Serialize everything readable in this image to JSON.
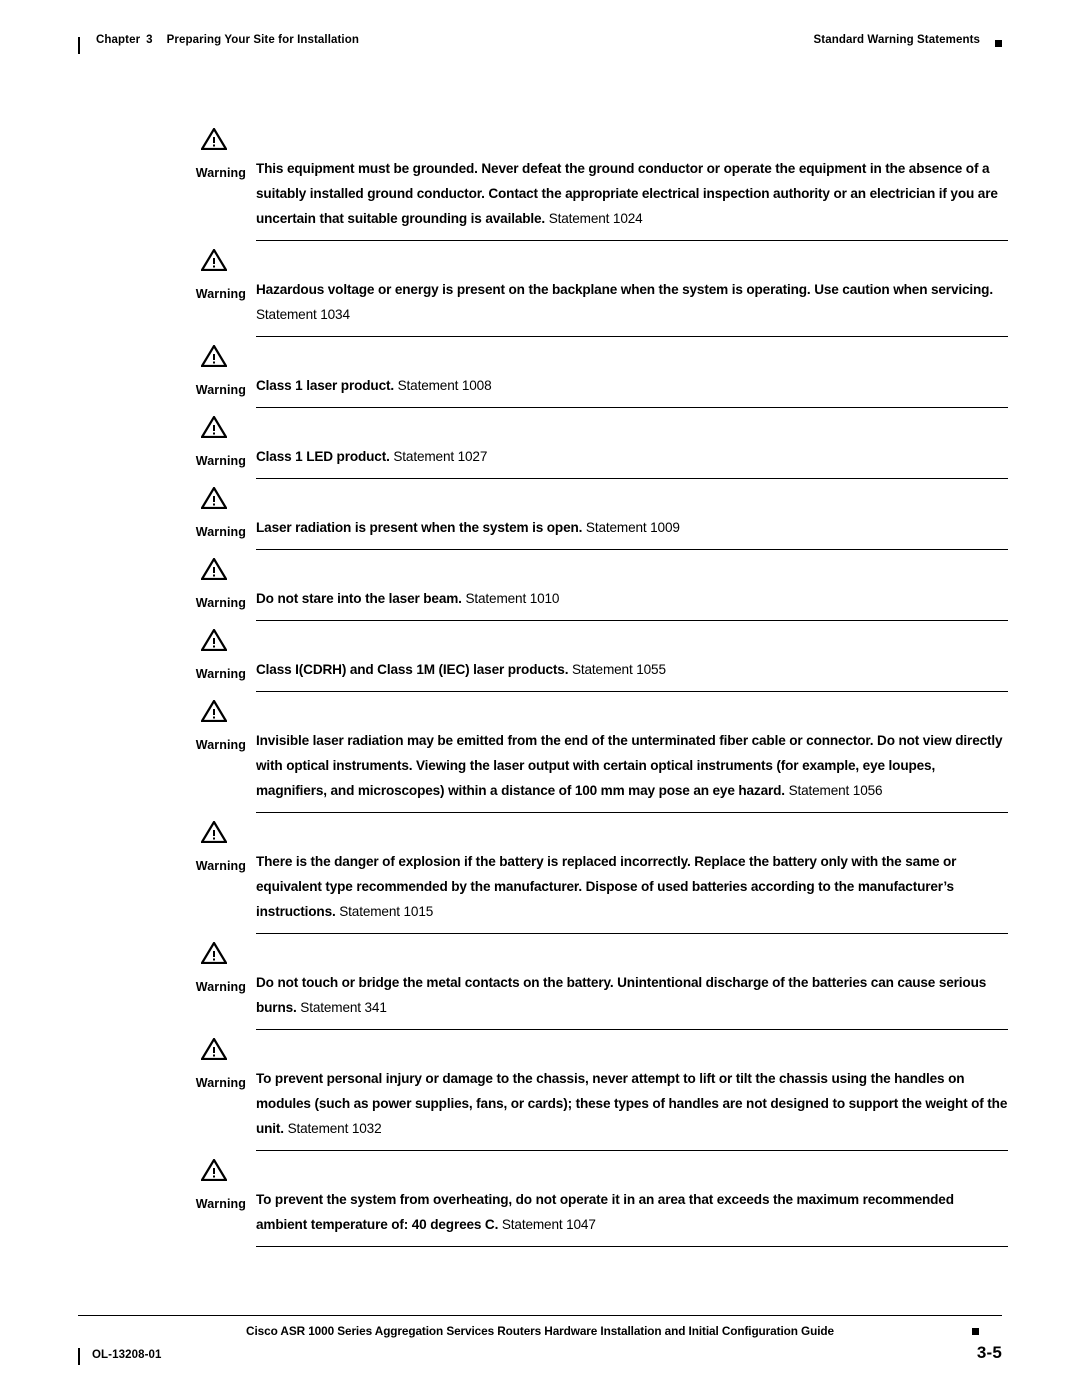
{
  "header": {
    "chapter_label": "Chapter",
    "chapter_number": "3",
    "chapter_title": "Preparing Your Site for Installation",
    "section_title": "Standard Warning Statements"
  },
  "warning_label": "Warning",
  "warnings": [
    {
      "text": "This equipment must be grounded. Never defeat the ground conductor or operate the equipment in the absence of a suitably installed ground conductor. Contact the appropriate electrical inspection authority or an electrician if you are uncertain that suitable grounding is available.",
      "statement": "Statement 1024"
    },
    {
      "text": "Hazardous voltage or energy is present on the backplane when the system is operating. Use caution when servicing.",
      "statement": "Statement 1034"
    },
    {
      "text": "Class 1 laser product.",
      "statement": "Statement 1008"
    },
    {
      "text": "Class 1 LED product.",
      "statement": "Statement 1027"
    },
    {
      "text": "Laser radiation is present when the system is open.",
      "statement": "Statement 1009"
    },
    {
      "text": "Do not stare into the laser beam.",
      "statement": "Statement 1010"
    },
    {
      "text": "Class I(CDRH) and Class 1M (IEC) laser products.",
      "statement": "Statement 1055"
    },
    {
      "text": "Invisible laser radiation may be emitted from the end of the unterminated fiber cable or connector. Do not view directly with optical instruments. Viewing the laser output with certain optical instruments (for example, eye loupes, magnifiers, and microscopes) within a distance of 100 mm may pose an eye hazard.",
      "statement": "Statement 1056"
    },
    {
      "text": "There is the danger of explosion if the battery is replaced incorrectly.  Replace the battery only with the same or equivalent type recommended by the manufacturer. Dispose of used batteries according to the manufacturer’s instructions.",
      "statement": "Statement 1015"
    },
    {
      "text": "Do not touch or bridge the metal contacts on the battery. Unintentional discharge of the batteries can cause serious burns.",
      "statement": "Statement 341"
    },
    {
      "text": "To prevent personal injury or damage to the chassis, never attempt to lift or tilt the chassis using the handles on modules (such as power supplies, fans, or cards); these types of handles are not designed to support the weight of the unit.",
      "statement": "Statement 1032"
    },
    {
      "text": "To prevent the system from overheating, do not operate it in an area that exceeds the maximum recommended ambient temperature of: 40 degrees C.",
      "statement": "Statement 1047"
    }
  ],
  "footer": {
    "title": "Cisco ASR 1000 Series Aggregation Services Routers Hardware Installation and Initial Configuration Guide",
    "doc_id": "OL-13208-01",
    "page_number": "3-5"
  }
}
